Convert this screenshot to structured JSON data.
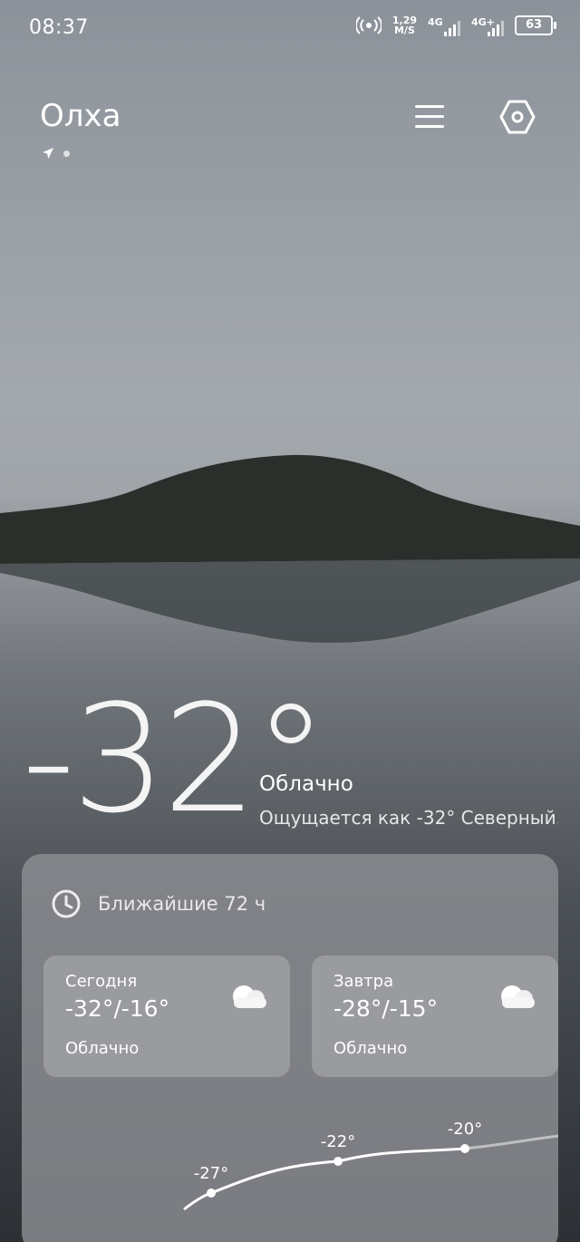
{
  "status_bar": {
    "time": "08:37",
    "speed_value": "1,29",
    "speed_unit": "M/S",
    "net1": "4G",
    "net2": "4G+",
    "battery": "63"
  },
  "header": {
    "city": "Олха",
    "menu_icon": "menu-icon",
    "settings_icon": "settings-icon"
  },
  "current": {
    "temperature": "-32°",
    "condition": "Облачно",
    "feels_like": "Ощущается как -32° Северный.."
  },
  "forecast_panel": {
    "title": "Ближайшие 72 ч",
    "days": [
      {
        "name": "Сегодня",
        "range": "-32°/-16°",
        "condition": "Облачно",
        "icon": "cloud-icon"
      },
      {
        "name": "Завтра",
        "range": "-28°/-15°",
        "condition": "Облачно",
        "icon": "cloud-icon"
      }
    ]
  },
  "chart_data": {
    "type": "line",
    "labels": [
      "-27°",
      "-22°",
      "-20°"
    ],
    "values": [
      -27,
      -22,
      -20
    ]
  }
}
